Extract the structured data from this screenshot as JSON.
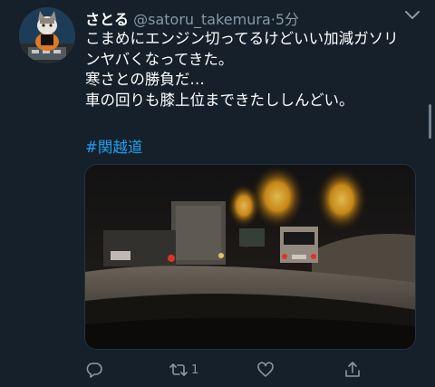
{
  "tweet": {
    "display_name": "さとる",
    "handle": "@satoru_takemura",
    "separator": "·",
    "time": "5分",
    "text_lines": [
      "こまめにエンジン切ってるけどいい加減ガソリ",
      "ンヤバくなってきた。",
      "寒さとの勝負だ…",
      "車の回りも膝上位まできたししんどい。"
    ],
    "hashtag": "#関越道"
  },
  "actions": {
    "reply_icon": "reply-icon",
    "retweet_icon": "retweet-icon",
    "retweet_count": "1",
    "like_icon": "heart-icon",
    "share_icon": "share-icon"
  },
  "colors": {
    "background": "#15202b",
    "secondary_text": "#8899a6",
    "link": "#1da1f2"
  }
}
